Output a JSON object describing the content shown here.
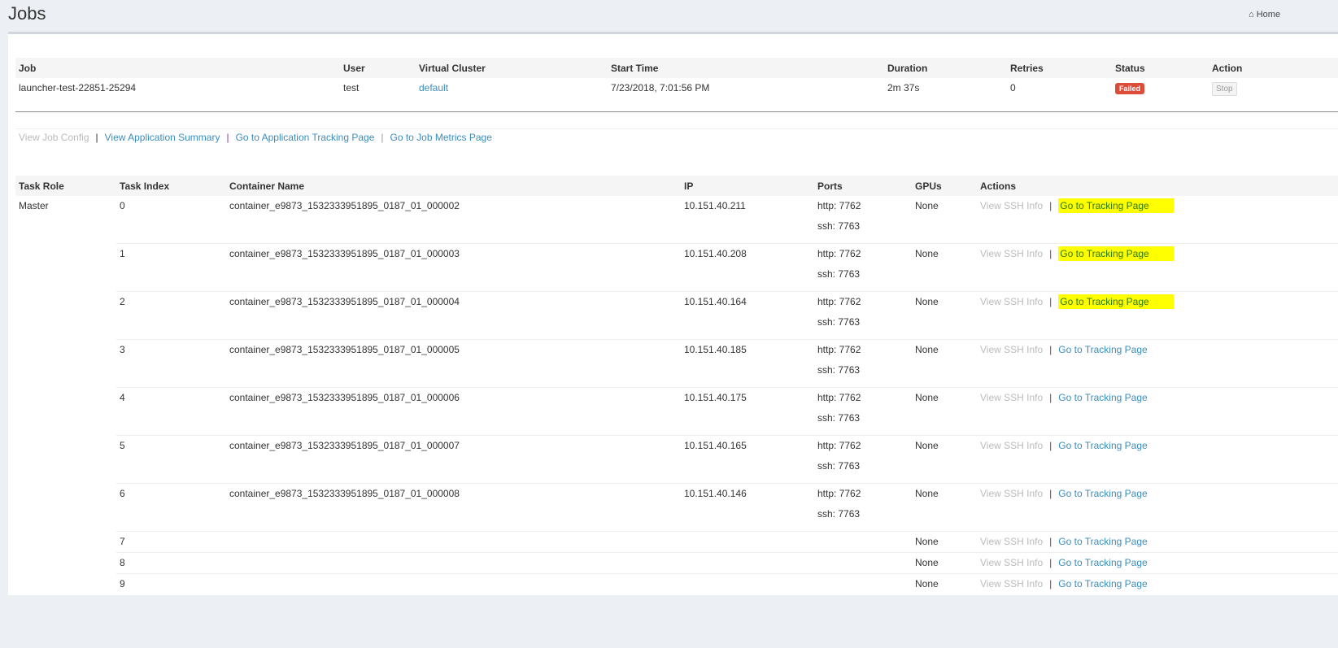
{
  "header": {
    "title": "Jobs",
    "breadcrumb": "Home",
    "home_icon": "home-icon"
  },
  "job_table": {
    "columns": [
      "Job",
      "User",
      "Virtual Cluster",
      "Start Time",
      "Duration",
      "Retries",
      "Status",
      "Action"
    ],
    "row": {
      "job": "launcher-test-22851-25294",
      "user": "test",
      "virtual_cluster": "default",
      "start_time": "7/23/2018, 7:01:56 PM",
      "duration": "2m 37s",
      "retries": "0",
      "status": "Failed",
      "action": "Stop"
    }
  },
  "links": {
    "view_job_config": "View Job Config",
    "view_app_summary": "View Application Summary",
    "app_tracking": "Go to Application Tracking Page",
    "job_metrics": "Go to Job Metrics Page",
    "separator": "|"
  },
  "task_table": {
    "columns": [
      "Task Role",
      "Task Index",
      "Container Name",
      "IP",
      "Ports",
      "GPUs",
      "Actions"
    ],
    "role": "Master",
    "ssh_label": "View SSH Info",
    "tracking_label": "Go to Tracking Page",
    "rows": [
      {
        "index": "0",
        "container": "container_e9873_1532333951895_0187_01_000002",
        "ip": "10.151.40.211",
        "http": "http: 7762",
        "ssh": "ssh: 7763",
        "gpus": "None",
        "highlighted": true
      },
      {
        "index": "1",
        "container": "container_e9873_1532333951895_0187_01_000003",
        "ip": "10.151.40.208",
        "http": "http: 7762",
        "ssh": "ssh: 7763",
        "gpus": "None",
        "highlighted": true
      },
      {
        "index": "2",
        "container": "container_e9873_1532333951895_0187_01_000004",
        "ip": "10.151.40.164",
        "http": "http: 7762",
        "ssh": "ssh: 7763",
        "gpus": "None",
        "highlighted": true
      },
      {
        "index": "3",
        "container": "container_e9873_1532333951895_0187_01_000005",
        "ip": "10.151.40.185",
        "http": "http: 7762",
        "ssh": "ssh: 7763",
        "gpus": "None"
      },
      {
        "index": "4",
        "container": "container_e9873_1532333951895_0187_01_000006",
        "ip": "10.151.40.175",
        "http": "http: 7762",
        "ssh": "ssh: 7763",
        "gpus": "None"
      },
      {
        "index": "5",
        "container": "container_e9873_1532333951895_0187_01_000007",
        "ip": "10.151.40.165",
        "http": "http: 7762",
        "ssh": "ssh: 7763",
        "gpus": "None"
      },
      {
        "index": "6",
        "container": "container_e9873_1532333951895_0187_01_000008",
        "ip": "10.151.40.146",
        "http": "http: 7762",
        "ssh": "ssh: 7763",
        "gpus": "None"
      },
      {
        "index": "7",
        "container": "",
        "ip": "",
        "http": "",
        "ssh": "",
        "gpus": "None"
      },
      {
        "index": "8",
        "container": "",
        "ip": "",
        "http": "",
        "ssh": "",
        "gpus": "None"
      },
      {
        "index": "9",
        "container": "",
        "ip": "",
        "http": "",
        "ssh": "",
        "gpus": "None"
      }
    ]
  },
  "colors": {
    "link": "#3c8dbc",
    "failed": "#dd4b39",
    "highlight": "#ffff00"
  }
}
